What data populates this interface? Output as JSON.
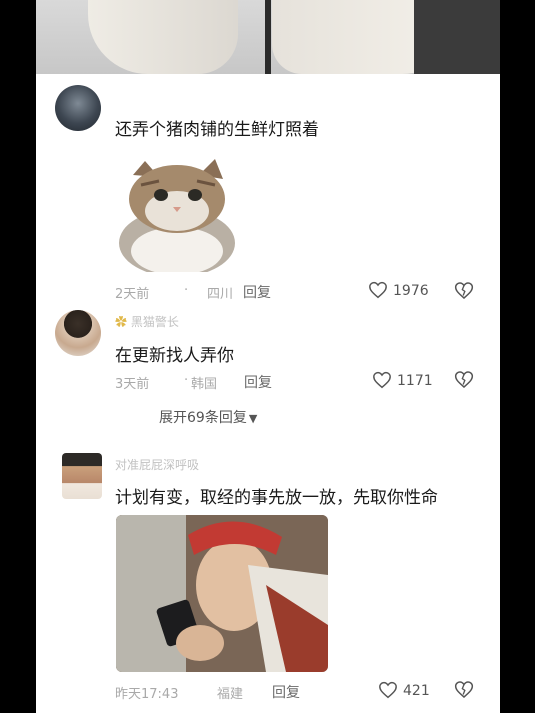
{
  "comments": [
    {
      "username": "       ",
      "text": "还弄个猪肉铺的生鲜灯照着",
      "time": "2天前",
      "location": "四川",
      "reply_label": "回复",
      "likes": "1976"
    },
    {
      "username": "黑猫警长",
      "text": "在更新找人弄你",
      "time": "3天前",
      "location": "韩国",
      "reply_label": "回复",
      "likes": "1171",
      "expand_label": "展开69条回复"
    },
    {
      "username": "对准屁屁深呼吸",
      "text": "计划有变，取经的事先放一放，先取你性命",
      "time": "昨天17:43",
      "location": "福建",
      "reply_label": "回复",
      "likes": "421"
    }
  ],
  "colors": {
    "background": "#000000",
    "panel": "#ffffff",
    "text": "#1a1a1a",
    "meta": "#a9a9a9"
  },
  "icons": [
    "heart-icon",
    "broken-heart-icon",
    "chevron-down-icon"
  ]
}
